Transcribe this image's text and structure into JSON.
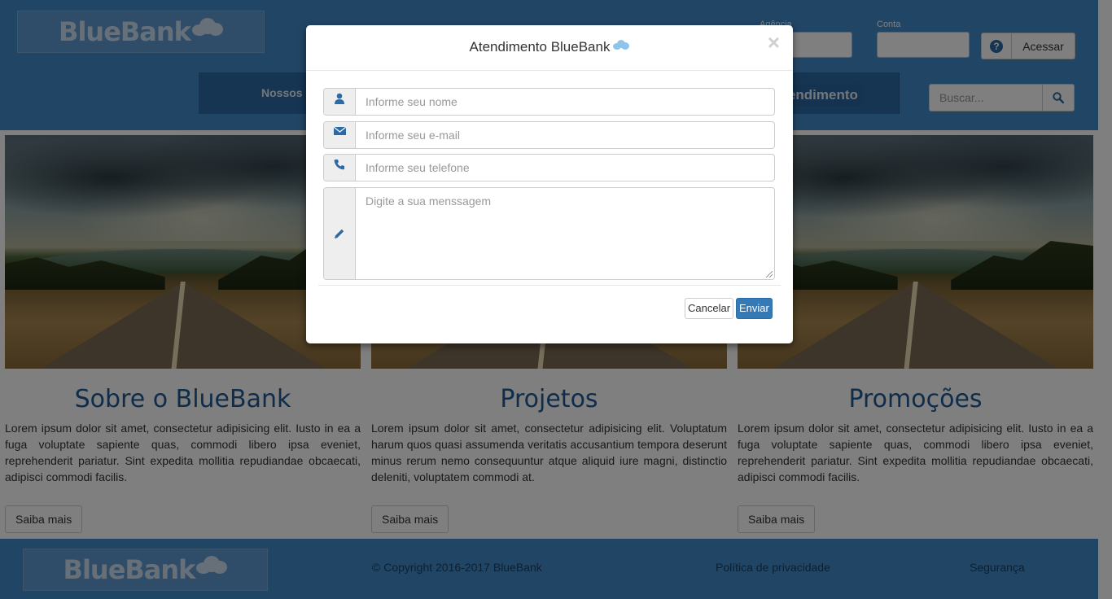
{
  "header": {
    "logo_text": "BlueBank",
    "agencia_label": "Agência",
    "conta_label": "Conta",
    "help_icon": "question-circle-icon",
    "acessar_label": "Acessar",
    "nav_left": "Nossos Produtos",
    "nav_right": "Atendimento",
    "search_placeholder": "Buscar...",
    "search_icon": "search-icon"
  },
  "cards": [
    {
      "title": "Sobre o BlueBank",
      "text": "Lorem ipsum dolor sit amet, consectetur adipisicing elit. Iusto in ea a fuga voluptate sapiente quas, commodi libero ipsa eveniet, reprehenderit pariatur. Sint expedita mollitia repudiandae obcaecati, adipisci commodi facilis.",
      "button": "Saiba mais"
    },
    {
      "title": "Projetos",
      "text": "Lorem ipsum dolor sit amet, consectetur adipisicing elit. Voluptatum harum quos quasi assumenda veritatis accusantium tempora deserunt minus rerum nemo consequuntur atque aliquid iure magni, distinctio deleniti, voluptatem commodi at.",
      "button": "Saiba mais"
    },
    {
      "title": "Promoções",
      "text": "Lorem ipsum dolor sit amet, consectetur adipisicing elit. Iusto in ea a fuga voluptate sapiente quas, commodi libero ipsa eveniet, reprehenderit pariatur. Sint expedita mollitia repudiandae obcaecati, adipisci commodi facilis.",
      "button": "Saiba mais"
    }
  ],
  "footer": {
    "logo_text": "BlueBank",
    "copyright": "© Copyright 2016-2017 BlueBank",
    "privacy": "Política de privacidade",
    "security": "Segurança"
  },
  "modal": {
    "title": "Atendimento BlueBank",
    "close_glyph": "×",
    "fields": {
      "name": {
        "icon": "user-icon",
        "placeholder": "Informe seu nome"
      },
      "email": {
        "icon": "envelope-icon",
        "placeholder": "Informe seu e-mail"
      },
      "phone": {
        "icon": "phone-icon",
        "placeholder": "Informe seu telefone"
      },
      "message": {
        "icon": "pencil-icon",
        "placeholder": "Digite a sua menssagem"
      }
    },
    "cancel_label": "Cancelar",
    "send_label": "Enviar"
  },
  "colors": {
    "brand_blue": "#428bca",
    "nav_blue": "#2b6aa6",
    "primary_button": "#337ab7",
    "title_blue": "#1e5a96"
  }
}
